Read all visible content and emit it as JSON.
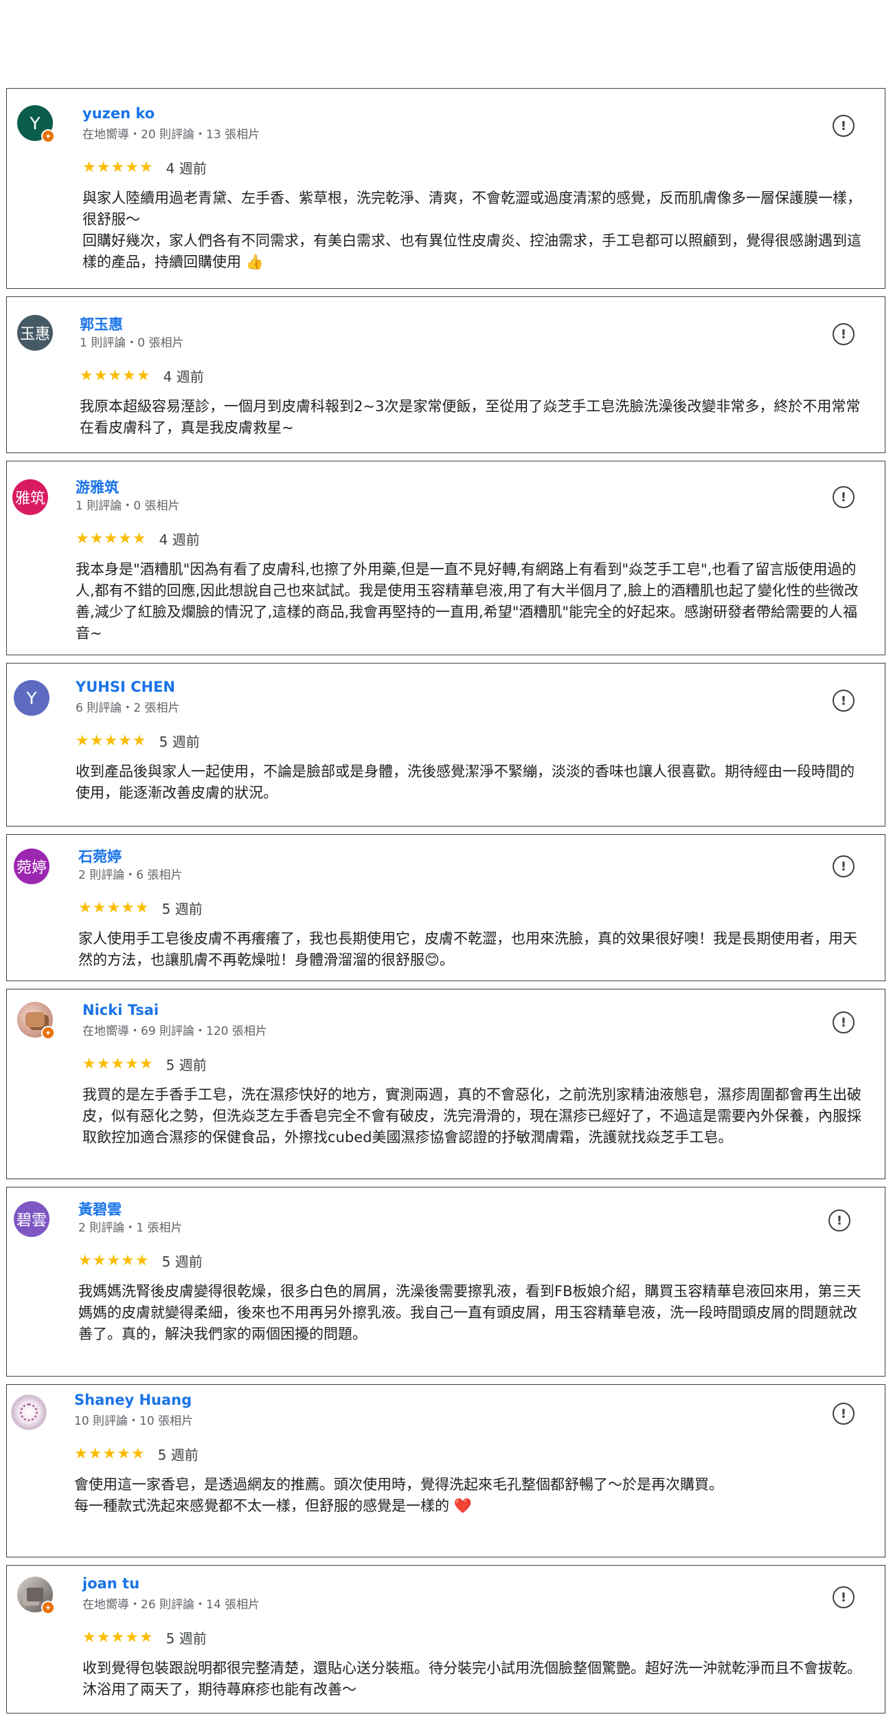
{
  "icons": {
    "flag": "report-flag-icon",
    "badge": "local-guide-badge-icon",
    "star": "star-icon"
  },
  "colors": {
    "name": "#1a73e8",
    "star": "#fbbc04",
    "badge": "#e8710a"
  },
  "reviews": [
    {
      "avatar_text": "Y",
      "avatar_color": "#0b5d4b",
      "name": "yuzen ko",
      "meta": "在地嚮導・20 則評論・13 張相片",
      "stars": "★★★★★",
      "when": "4 週前",
      "text": "與家人陸續用過老青黛、左手香、紫草根，洗完乾淨、清爽，不會乾澀或過度清潔的感覺，反而肌膚像多一層保護膜一樣，很舒服～\n回購好幾次，家人們各有不同需求，有美白需求、也有異位性皮膚炎、控油需求，手工皂都可以照顧到，覺得很感謝遇到這樣的產品，持續回購使用 👍"
    },
    {
      "avatar_text": "玉惠",
      "avatar_color": "#455a64",
      "name": "郭玉惠",
      "meta": "1 則評論・0 張相片",
      "stars": "★★★★★",
      "when": "4 週前",
      "text": "我原本超級容易溼診，一個月到皮膚科報到2~3次是家常便飯，至從用了焱芝手工皂洗臉洗澡後改變非常多，終於不用常常在看皮膚科了，真是我皮膚救星~"
    },
    {
      "avatar_text": "雅筑",
      "avatar_color": "#d81b60",
      "name": "游雅筑",
      "meta": "1 則評論・0 張相片",
      "stars": "★★★★★",
      "when": "4 週前",
      "text": "我本身是\"酒糟肌\"因為有看了皮膚科,也擦了外用藥,但是一直不見好轉,有網路上有看到\"焱芝手工皂\",也看了留言版使用過的人,都有不錯的回應,因此想說自己也來試試。我是使用玉容精華皂液,用了有大半個月了,臉上的酒糟肌也起了變化性的些微改善,減少了紅臉及爛臉的情況了,這樣的商品,我會再堅持的一直用,希望\"酒糟肌\"能完全的好起來。感謝研發者帶給需要的人福音~"
    },
    {
      "avatar_text": "Y",
      "avatar_color": "#5c6bc0",
      "name": "YUHSI CHEN",
      "meta": "6 則評論・2 張相片",
      "stars": "★★★★★",
      "when": "5 週前",
      "text": "收到產品後與家人一起使用，不論是臉部或是身體，洗後感覺潔淨不緊繃，淡淡的香味也讓人很喜歡。期待經由一段時間的使用，能逐漸改善皮膚的狀況。"
    },
    {
      "avatar_text": "菀婷",
      "avatar_color": "#9c27b0",
      "name": "石菀婷",
      "meta": "2 則評論・6 張相片",
      "stars": "★★★★★",
      "when": "5 週前",
      "text": "家人使用手工皂後皮膚不再癢癢了，我也長期使用它，皮膚不乾澀，也用來洗臉，真的效果很好噢！我是長期使用者，用天然的方法，也讓肌膚不再乾燥啦！身體滑溜溜的很舒服😊。"
    },
    {
      "avatar_text": "",
      "avatar_color": "#d9a99a",
      "name": "Nicki Tsai",
      "meta": "在地嚮導・69 則評論・120 張相片",
      "stars": "★★★★★",
      "when": "5 週前",
      "text": "我買的是左手香手工皂，洗在濕疹快好的地方，實測兩週，真的不會惡化，之前洗別家精油液態皂，濕疹周圍都會再生出破皮，似有惡化之勢，但洗焱芝左手香皂完全不會有破皮，洗完滑滑的，現在濕疹已經好了，不過這是需要內外保養，內服採取飲控加適合濕疹的保健食品，外擦找cubed美國濕疹協會認證的抒敏潤膚霜，洗護就找焱芝手工皂。"
    },
    {
      "avatar_text": "碧雲",
      "avatar_color": "#7e57c2",
      "name": "黃碧雲",
      "meta": "2 則評論・1 張相片",
      "stars": "★★★★★",
      "when": "5 週前",
      "text": "我媽媽洗腎後皮膚變得很乾燥，很多白色的屑屑，洗澡後需要擦乳液，看到FB板娘介紹，購買玉容精華皂液回來用，第三天媽媽的皮膚就變得柔細，後來也不用再另外擦乳液。我自己一直有頭皮屑，用玉容精華皂液，洗一段時間頭皮屑的問題就改善了。真的，解決我們家的兩個困擾的問題。"
    },
    {
      "avatar_text": "",
      "avatar_color": "#f1e4ef",
      "name": "Shaney Huang",
      "meta": "10 則評論・10 張相片",
      "stars": "★★★★★",
      "when": "5 週前",
      "text": "會使用這一家香皂，是透過網友的推薦。頭次使用時，覺得洗起來毛孔整個都舒暢了～於是再次購買。\n每一種款式洗起來感覺都不太一樣，但舒服的感覺是一樣的 ❤️"
    },
    {
      "avatar_text": "",
      "avatar_color": "#8f8a86",
      "name": "joan tu",
      "meta": "在地嚮導・26 則評論・14 張相片",
      "stars": "★★★★★",
      "when": "5 週前",
      "text": "收到覺得包裝跟說明都很完整清楚，還貼心送分裝瓶。待分裝完小試用洗個臉整個驚艷。超好洗一沖就乾淨而且不會拔乾。沐浴用了兩天了，期待蕁麻疹也能有改善～"
    }
  ]
}
